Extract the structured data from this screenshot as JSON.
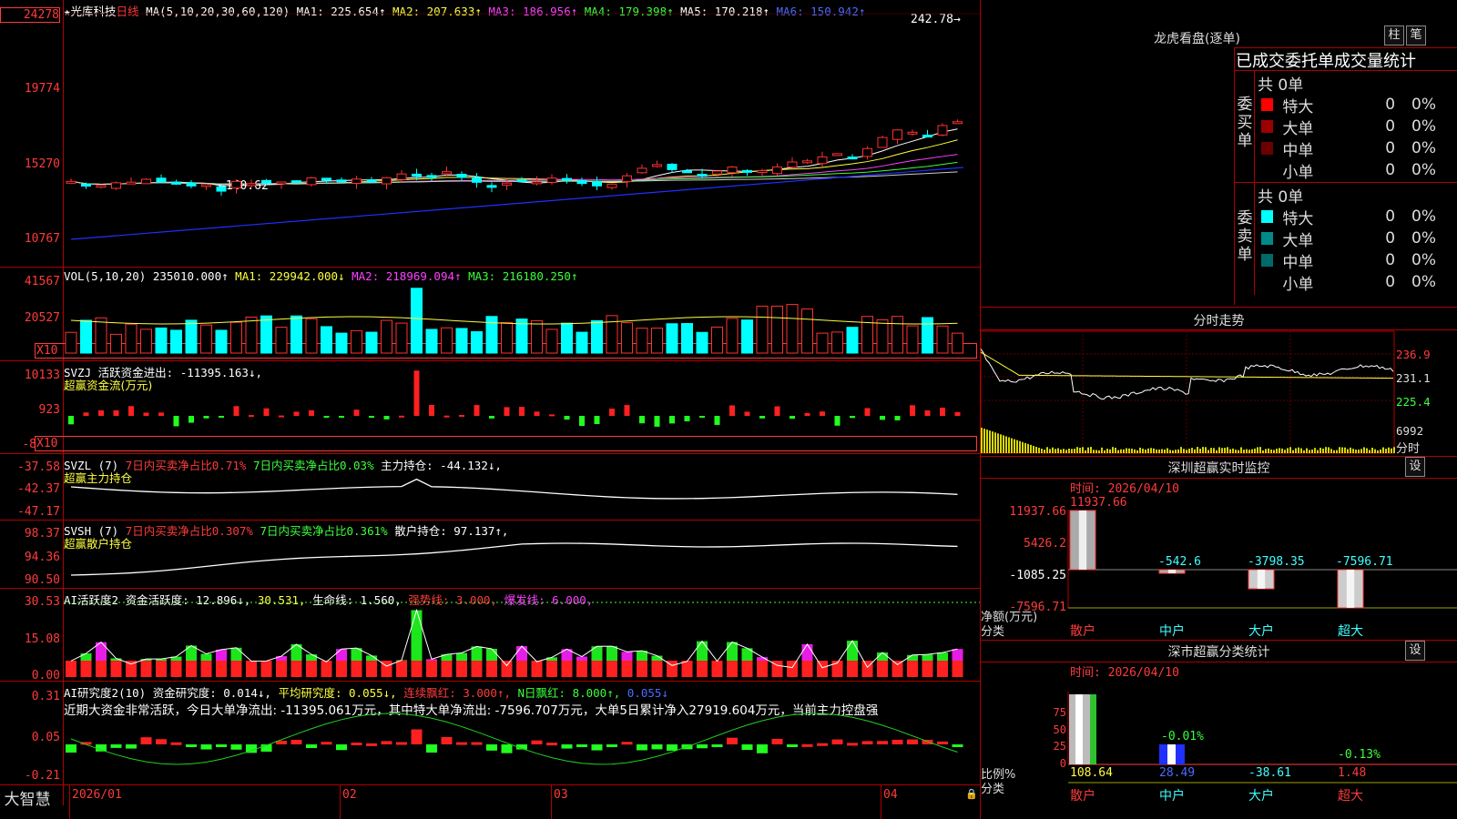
{
  "stock": {
    "name": "★光库科技",
    "period": "日线",
    "ma_header": {
      "params": "MA(5,10,20,30,60,120)",
      "ma1": "MA1: 225.654↑",
      "ma2": "MA2: 207.633↑",
      "ma3": "MA3: 186.956↑",
      "ma4": "MA4: 179.398↑",
      "ma5": "MA5: 170.218↑",
      "ma6": "MA6: 150.942↑"
    },
    "price_axis": [
      "24278",
      "19774",
      "15270",
      "10767"
    ],
    "high_label": "242.78→",
    "low_label": "←140.62"
  },
  "volume": {
    "header": {
      "params": "VOL(5,10,20)",
      "vol": "235010.000↑",
      "ma1": "MA1: 229942.000↓",
      "ma2": "MA2: 218969.094↑",
      "ma3": "MA3: 216180.250↑"
    },
    "axis": [
      "41567",
      "20527"
    ],
    "unit": "X10"
  },
  "svzj": {
    "header": {
      "code": "SVZJ",
      "label": "活跃资金进出: -11395.163↓,"
    },
    "subtitle": "超赢资金流(万元)",
    "axis": [
      "10133",
      "923",
      "-8"
    ],
    "unit": "X10"
  },
  "svzl": {
    "header": {
      "code": "SVZL (7)",
      "a": "7日内买卖净占比0.71%",
      "b": "7日内买卖净占比0.03%",
      "c": "主力持仓: -44.132↓,"
    },
    "subtitle": "超赢主力持仓",
    "axis": [
      "-37.58",
      "-42.37",
      "-47.17"
    ]
  },
  "svsh": {
    "header": {
      "code": "SVSH (7)",
      "a": "7日内买卖净占比0.307%",
      "b": "7日内买卖净占比0.361%",
      "c": "散户持仓: 97.137↑,"
    },
    "subtitle": "超赢散户持仓",
    "axis": [
      "98.37",
      "94.36",
      "90.50"
    ]
  },
  "ai_active": {
    "header": {
      "a": "AI活跃度2 资金活跃度: 12.896↓,",
      "b": "30.531,",
      "c": "生命线: 1.560,",
      "d": "强势线: 3.000,",
      "e": "爆发线: 6.000,"
    },
    "axis": [
      "30.53",
      "15.08",
      "0.00"
    ]
  },
  "ai_research": {
    "header": {
      "a": "AI研究度2(10) 资金研究度: 0.014↓,",
      "b": "平均研究度: 0.055↓,",
      "c": "连续飘红: 3.000↑,",
      "d": "N日飘红: 8.000↑,",
      "e": "0.055↓"
    },
    "note": "近期大资金非常活跃，今日大单净流出: -11395.061万元，其中特大单净流出: -7596.707万元，大单5日累计净入27919.604万元，当前主力控盘强",
    "axis": [
      "0.31",
      "0.05",
      "-0.21"
    ]
  },
  "date_axis": [
    "2026/01",
    "02",
    "03",
    "04"
  ],
  "logo": "大智慧",
  "lhb": {
    "title": "龙虎看盘(逐单)",
    "btn_bar": "柱",
    "btn_pen": "笔",
    "head": "已成交委托单成交量统计",
    "buy": {
      "side": "委买单",
      "total": "共 0单",
      "rows": [
        {
          "label": "特大",
          "v": "0",
          "p": "0%",
          "c": "#ff0000"
        },
        {
          "label": "大单",
          "v": "0",
          "p": "0%",
          "c": "#9a0000"
        },
        {
          "label": "中单",
          "v": "0",
          "p": "0%",
          "c": "#6a0000"
        },
        {
          "label": "小单",
          "v": "0",
          "p": "0%",
          "c": ""
        }
      ]
    },
    "sell": {
      "side": "委卖单",
      "total": "共 0单",
      "rows": [
        {
          "label": "特大",
          "v": "0",
          "p": "0%",
          "c": "#00ffff"
        },
        {
          "label": "大单",
          "v": "0",
          "p": "0%",
          "c": "#008a8a"
        },
        {
          "label": "中单",
          "v": "0",
          "p": "0%",
          "c": "#006a6a"
        },
        {
          "label": "小单",
          "v": "0",
          "p": "0%",
          "c": ""
        }
      ]
    }
  },
  "intraday": {
    "title": "分时走势",
    "axis": [
      "236.9",
      "231.1",
      "225.4",
      "6992"
    ],
    "unit": "分时"
  },
  "sz_monitor": {
    "title": "深圳超赢实时监控",
    "btn": "设",
    "time": "时间: 2026/04/10",
    "axis": [
      "11937.66",
      "5426.2",
      "-1085.25",
      "-7596.71"
    ],
    "bars": [
      {
        "cat": "散户",
        "value": "11937.66"
      },
      {
        "cat": "中户",
        "value": "-542.6"
      },
      {
        "cat": "大户",
        "value": "-3798.35"
      },
      {
        "cat": "超大",
        "value": "-7596.71"
      }
    ],
    "ylabel": "净额(万元)",
    "xlabel": "分类"
  },
  "sz_class": {
    "title": "深市超赢分类统计",
    "btn": "设",
    "time": "时间: 2026/04/10",
    "axis": [
      "75",
      "50",
      "25",
      "0"
    ],
    "bars": [
      {
        "cat": "散户",
        "value": "108.64",
        "top": ""
      },
      {
        "cat": "中户",
        "value": "28.49",
        "top": "-0.01%"
      },
      {
        "cat": "大户",
        "value": "-38.61",
        "top": ""
      },
      {
        "cat": "超大",
        "value": "1.48",
        "top": "-0.13%"
      }
    ],
    "ylabel": "比例%",
    "xlabel": "分类"
  }
}
